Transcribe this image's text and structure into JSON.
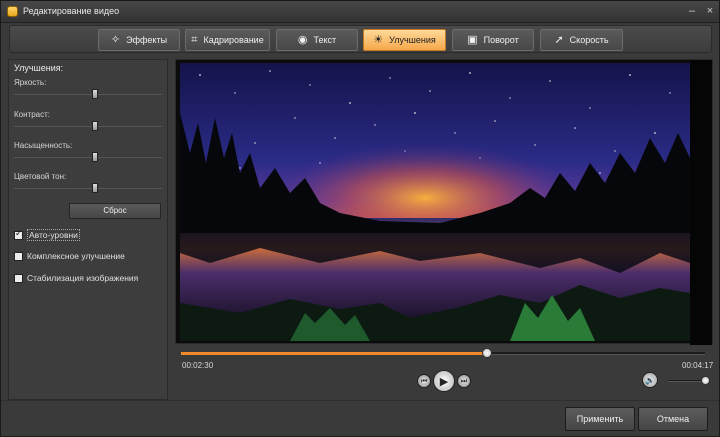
{
  "window": {
    "title": "Редактирование видео",
    "minimize_glyph": "–",
    "close_glyph": "×"
  },
  "tabs": [
    {
      "label": "Эффекты",
      "icon": "effects-icon",
      "glyph": "✧",
      "active": false
    },
    {
      "label": "Кадрирование",
      "icon": "crop-icon",
      "glyph": "⌗",
      "active": false
    },
    {
      "label": "Текст",
      "icon": "text-icon",
      "glyph": "◉",
      "active": false
    },
    {
      "label": "Улучшения",
      "icon": "enhance-icon",
      "glyph": "☀",
      "active": true
    },
    {
      "label": "Поворот",
      "icon": "rotate-icon",
      "glyph": "▣",
      "active": false
    },
    {
      "label": "Скорость",
      "icon": "speed-icon",
      "glyph": "➚",
      "active": false
    }
  ],
  "enhancements": {
    "heading": "Улучшения:",
    "sliders": [
      {
        "label": "Яркость:",
        "value": 0.55
      },
      {
        "label": "Контраст:",
        "value": 0.55
      },
      {
        "label": "Насыщенность:",
        "value": 0.55
      },
      {
        "label": "Цветовой тон:",
        "value": 0.55
      }
    ],
    "reset_label": "Сброс",
    "checkboxes": [
      {
        "label": "Авто-уровни",
        "checked": true
      },
      {
        "label": "Комплексное улучшение",
        "checked": false
      },
      {
        "label": "Стабилизация изображения",
        "checked": false
      }
    ]
  },
  "player": {
    "current_time": "00:02:30",
    "total_time": "00:04:17",
    "progress": 0.584,
    "volume": 0.95,
    "prev_glyph": "⏮",
    "play_glyph": "▶",
    "next_glyph": "⏭",
    "volume_glyph": "🔊"
  },
  "buttons": {
    "apply": "Применить",
    "cancel": "Отмена"
  },
  "colors": {
    "accent": "#f28a2a",
    "active_tab": "#f6a84a"
  }
}
